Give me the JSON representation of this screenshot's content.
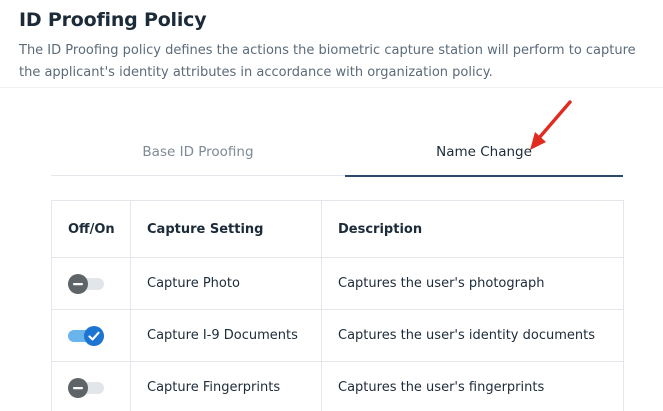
{
  "header": {
    "title": "ID Proofing Policy",
    "description": "The ID Proofing policy defines the actions the biometric capture station will perform to capture the applicant's identity attributes in accordance with organization policy."
  },
  "tabs": [
    {
      "label": "Base ID Proofing",
      "active": false
    },
    {
      "label": "Name Change",
      "active": true
    }
  ],
  "table": {
    "columns": [
      "Off/On",
      "Capture Setting",
      "Description"
    ],
    "rows": [
      {
        "enabled": false,
        "setting": "Capture Photo",
        "description": "Captures the user's photograph"
      },
      {
        "enabled": true,
        "setting": "Capture I-9 Documents",
        "description": "Captures the user's identity documents"
      },
      {
        "enabled": false,
        "setting": "Capture Fingerprints",
        "description": "Captures the user's fingerprints"
      }
    ]
  },
  "icons": {
    "toggle_off": "minus-icon",
    "toggle_on": "check-icon",
    "annotation": "red-arrow-icon"
  },
  "colors": {
    "title": "#1c2b39",
    "description": "#5b6b7a",
    "active_tab_underline": "#2a4a6b",
    "toggle_on_track": "#6ab4ee",
    "toggle_on_thumb": "#1e74d1",
    "toggle_off_track": "#e2e5e9",
    "toggle_off_thumb": "#5f6469",
    "annotation_arrow": "#e02b20"
  }
}
